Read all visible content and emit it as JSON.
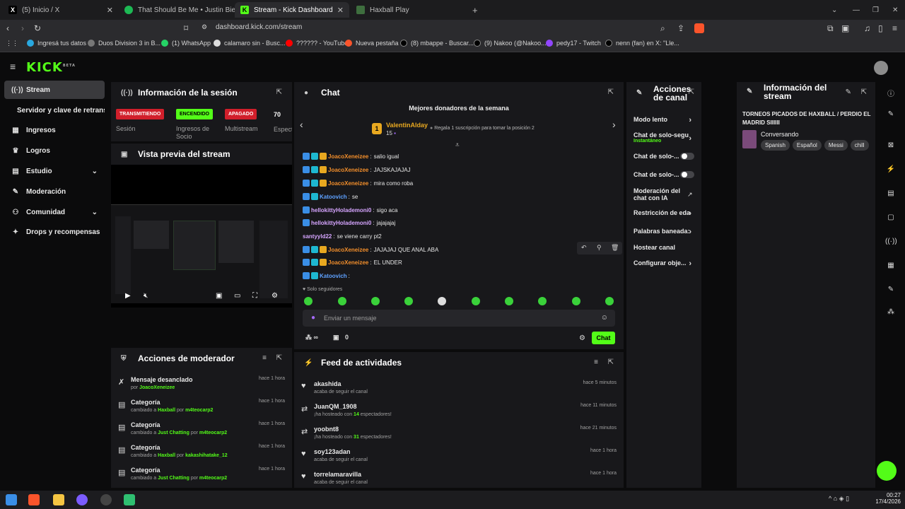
{
  "browser": {
    "tabs": [
      {
        "title": "(5) Inicio / X",
        "icon": "x-icon",
        "color": "#000000"
      },
      {
        "title": "That Should Be Me • Justin Bieber",
        "icon": "spotify-icon",
        "color": "#1db954"
      },
      {
        "title": "Stream - Kick Dashboard",
        "icon": "kick-icon",
        "color": "#53fc18"
      },
      {
        "title": "Haxball Play",
        "icon": "haxball-icon",
        "color": "#3e6e3e"
      }
    ],
    "url": "dashboard.kick.com/stream",
    "bookmarks": [
      "Ingresá tus datos",
      "Duos Division 3 in B...",
      "(1) WhatsApp",
      "calamaro sin - Busc...",
      "?????? - YouTube",
      "Nueva pestaña",
      "(8) mbappe - Buscar...",
      "(9) Nakoo (@Nakoo...",
      "pedy17 - Twitch",
      "nenn (fan) en X: \"Lle..."
    ]
  },
  "kick": {
    "logo": "KICK",
    "logo_sup": "BETA"
  },
  "sidebar": {
    "items": [
      {
        "label": "Stream",
        "icon": "stream-icon"
      },
      {
        "label": "Servidor y clave de retransmisión",
        "icon": ""
      },
      {
        "label": "Ingresos",
        "icon": "bank-icon"
      },
      {
        "label": "Logros",
        "icon": "trophy-icon"
      },
      {
        "label": "Estudio",
        "icon": "studio-icon"
      },
      {
        "label": "Moderación",
        "icon": "wrench-icon"
      },
      {
        "label": "Comunidad",
        "icon": "people-icon"
      },
      {
        "label": "Drops y recompensas",
        "icon": "gift-icon"
      }
    ]
  },
  "session": {
    "title": "Información de la sesión",
    "stats": [
      {
        "badge": "TRANSMITIENDO",
        "label": "Sesión",
        "color": "#d11f2b"
      },
      {
        "badge": "ENCENDIDO",
        "label": "Ingresos de Socio",
        "color": "#53fc18"
      },
      {
        "badge": "APAGADO",
        "label": "Multistream",
        "color": "#d11f2b"
      },
      {
        "badge": "70",
        "label": "Espect"
      }
    ]
  },
  "preview": {
    "title": "Vista previa del stream"
  },
  "mod_actions": {
    "title": "Acciones de moderador",
    "rows": [
      {
        "title": "Mensaje desanclado",
        "pre": "por ",
        "a": "JoacoXeneizee",
        "mid": "",
        "b": "",
        "time": "hace 1 hora",
        "icon": "unpin-icon"
      },
      {
        "title": "Categoría",
        "pre": "cambiado a ",
        "a": "Haxball",
        "mid": " por ",
        "b": "m4teocarp2",
        "time": "hace 1 hora",
        "icon": "category-icon"
      },
      {
        "title": "Categoría",
        "pre": "cambiado a ",
        "a": "Just Chatting",
        "mid": " por ",
        "b": "m4teocarp2",
        "time": "hace 1 hora",
        "icon": "category-icon"
      },
      {
        "title": "Categoría",
        "pre": "cambiado a ",
        "a": "Haxball",
        "mid": " por ",
        "b": "kakashihatake_12",
        "time": "hace 1 hora",
        "icon": "category-icon"
      },
      {
        "title": "Categoría",
        "pre": "cambiado a ",
        "a": "Just Chatting",
        "mid": " por ",
        "b": "m4teocarp2",
        "time": "hace 1 hora",
        "icon": "category-icon"
      }
    ]
  },
  "chat": {
    "title": "Chat",
    "donors_title": "Mejores donadores de la semana",
    "top_donor": {
      "rank": "1",
      "name": "ValentinAlday",
      "count": "15"
    },
    "gift_prompt": "Regala 1 suscripción para tomar la posición 2",
    "messages": [
      {
        "user": "JoacoXeneizee",
        "text": "salio igual",
        "style": "orange",
        "badges": 3
      },
      {
        "user": "JoacoXeneizee",
        "text": "JAJSKAJAJAJ",
        "style": "orange",
        "badges": 3
      },
      {
        "user": "JoacoXeneizee",
        "text": "mira como roba",
        "style": "orange",
        "badges": 3
      },
      {
        "user": "Katoovich",
        "text": "se",
        "style": "blue",
        "badges": 2
      },
      {
        "user": "hellokittyHolademoni0",
        "text": "sigo aca",
        "style": "purple",
        "badges": 1
      },
      {
        "user": "hellokittyHolademoni0",
        "text": "jajajajaj",
        "style": "purple",
        "badges": 1
      },
      {
        "user": "santyyld22",
        "text": "se viene carry pt2",
        "style": "purple",
        "badges": 0
      },
      {
        "user": "JoacoXeneizee",
        "text": "JAJAJAJ QUE ANAL ABA",
        "style": "orange",
        "badges": 3
      },
      {
        "user": "JoacoXeneizee",
        "text": "EL UNDER",
        "style": "orange",
        "badges": 3
      },
      {
        "user": "Katoovich",
        "text": "",
        "style": "blue",
        "badges": 2
      }
    ],
    "followers_only": "Solo seguidores",
    "input_placeholder": "Enviar un mensaje",
    "points": "∞",
    "gifts": "0",
    "send": "Chat"
  },
  "feed": {
    "title": "Feed de actividades",
    "rows": [
      {
        "user": "akashida",
        "desc_pre": "acaba de seguir el canal",
        "num": "",
        "desc_post": "",
        "time": "hace 5 minutos",
        "icon": "heart-icon"
      },
      {
        "user": "JuanQM_1908",
        "desc_pre": "¡ha hosteado con ",
        "num": "14",
        "desc_post": " espectadores!",
        "time": "hace 11 minutos",
        "icon": "host-icon"
      },
      {
        "user": "yoobnt8",
        "desc_pre": "¡ha hosteado con ",
        "num": "31",
        "desc_post": " espectadores!",
        "time": "hace 21 minutos",
        "icon": "host-icon"
      },
      {
        "user": "soy123adan",
        "desc_pre": "acaba de seguir el canal",
        "num": "",
        "desc_post": "",
        "time": "hace 1 hora",
        "icon": "heart-icon"
      },
      {
        "user": "torrelamaravilla",
        "desc_pre": "acaba de seguir el canal",
        "num": "",
        "desc_post": "",
        "time": "hace 1 hora",
        "icon": "heart-icon"
      }
    ]
  },
  "channel": {
    "title": "Acciones de canal",
    "rows": [
      {
        "label": "Modo lento",
        "kind": "arrow"
      },
      {
        "label": "Chat de solo-segu",
        "sub": "Instantáneo",
        "kind": "arrow"
      },
      {
        "label": "Chat de solo-...",
        "kind": "toggle"
      },
      {
        "label": "Chat de solo-...",
        "kind": "toggle"
      },
      {
        "label": "Moderación del chat con IA",
        "kind": "external"
      },
      {
        "label": "Restricción de eda",
        "kind": "arrow"
      },
      {
        "label": "Palabras baneada:",
        "kind": "arrow"
      },
      {
        "label": "Hostear canal",
        "kind": "none"
      },
      {
        "label": "Configurar obje...",
        "kind": "arrow"
      }
    ]
  },
  "stream_info": {
    "title": "Información del stream",
    "stream_title": "TORNEOS PICADOS DE HAXBALL / PERDIO EL MADRID SIIIIII",
    "category": "Conversando",
    "tags": [
      "Spanish",
      "Español",
      "Messi",
      "chill"
    ]
  },
  "taskbar": {
    "time": "00:27",
    "date": "17/4/2026"
  }
}
